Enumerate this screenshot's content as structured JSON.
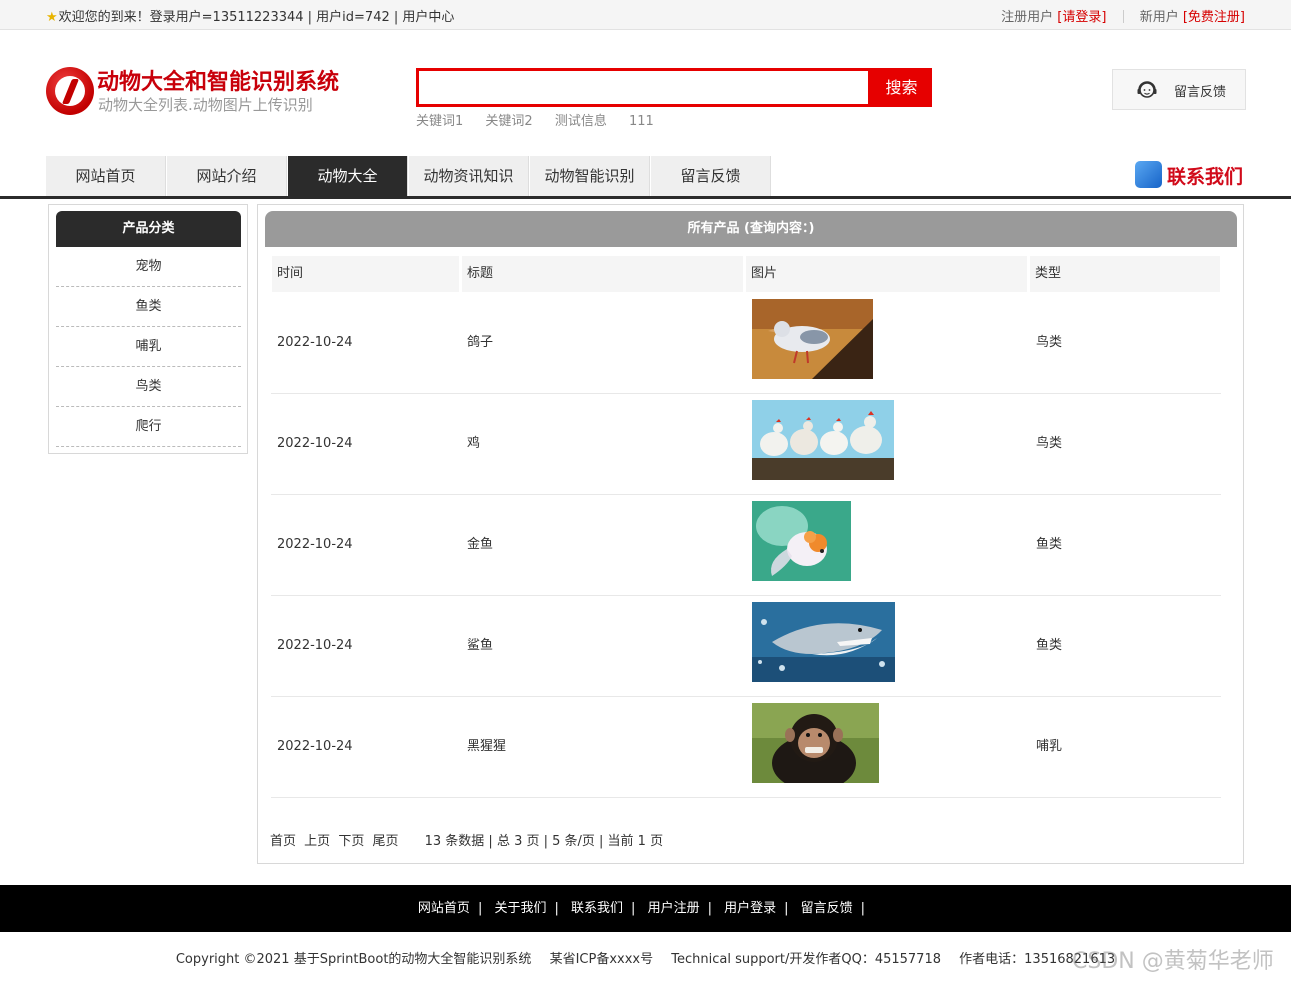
{
  "topbar": {
    "welcome": "欢迎您的到来！登录用户=13511223344 | 用户id=742 | 用户中心",
    "register_user_label": "注册用户",
    "login_link": "[请登录]",
    "new_user_label": "新用户",
    "signup_link": "[免费注册]"
  },
  "header": {
    "site_title": "动物大全和智能识别系统",
    "site_subtitle": "动物大全列表.动物图片上传识别",
    "search_placeholder": "",
    "search_button": "搜索",
    "keywords": [
      "关键词1",
      "关键词2",
      "测试信息",
      "111"
    ],
    "feedback_button": "留言反馈"
  },
  "nav": {
    "items": [
      "网站首页",
      "网站介绍",
      "动物大全",
      "动物资讯知识",
      "动物智能识别",
      "留言反馈"
    ],
    "active_index": 2,
    "contact_label": "联系我们"
  },
  "sidebar": {
    "title": "产品分类",
    "categories": [
      "宠物",
      "鱼类",
      "哺乳",
      "鸟类",
      "爬行"
    ]
  },
  "main": {
    "title": "所有产品 (查询内容：)",
    "columns": [
      "时间",
      "标题",
      "图片",
      "类型"
    ],
    "rows": [
      {
        "date": "2022-10-24",
        "title": "鸽子",
        "image": "pigeon-photo",
        "type": "鸟类"
      },
      {
        "date": "2022-10-24",
        "title": "鸡",
        "image": "chickens-photo",
        "type": "鸟类"
      },
      {
        "date": "2022-10-24",
        "title": "金鱼",
        "image": "goldfish-photo",
        "type": "鱼类"
      },
      {
        "date": "2022-10-24",
        "title": "鲨鱼",
        "image": "shark-photo",
        "type": "鱼类"
      },
      {
        "date": "2022-10-24",
        "title": "黑猩猩",
        "image": "chimpanzee-photo",
        "type": "哺乳"
      }
    ],
    "pager": {
      "first": "首页",
      "prev": "上页",
      "next": "下页",
      "last": "尾页",
      "summary": "13 条数据 | 总 3 页 | 5 条/页 | 当前 1 页"
    }
  },
  "footer": {
    "links": [
      "网站首页",
      "关于我们",
      "联系我们",
      "用户注册",
      "用户登录",
      "留言反馈"
    ],
    "copyright": "Copyright ©2021 基于SprintBoot的动物大全智能识别系统",
    "icp": "某省ICP备xxxx号",
    "support": "Technical support/开发作者QQ：45157718",
    "phone": "作者电话：13516821613",
    "watermark": "CSDN @黄菊华老师"
  },
  "colors": {
    "brand_red": "#e60000",
    "title_red": "#c8000a",
    "nav_active": "#2b2b2b",
    "table_header": "#9a9a9a"
  }
}
